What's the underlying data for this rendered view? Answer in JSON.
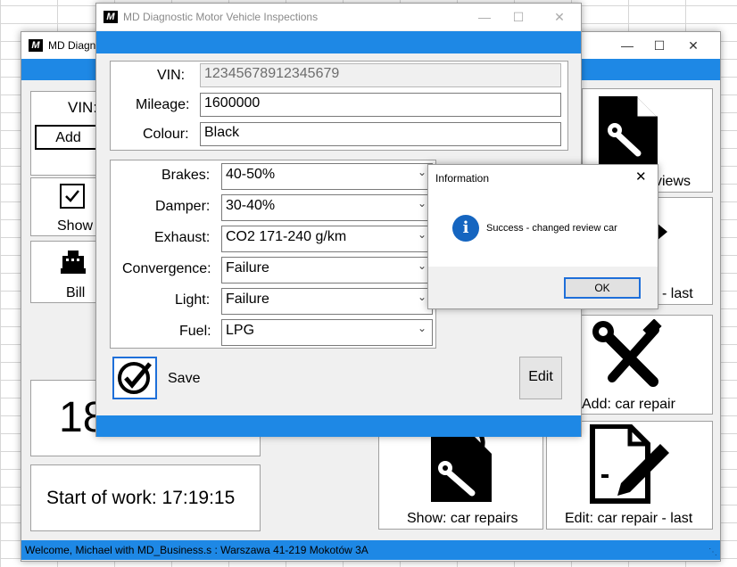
{
  "back_window": {
    "title": "MD Diagnost",
    "vin_label": "VIN:",
    "add_label": "Add",
    "show_label": "Show",
    "bill_label": "Bill",
    "big_number": "18",
    "start_of_work": "Start of work: 17:19:15",
    "reviews_label": "views",
    "last_label": "- last",
    "add_repair_label": "Add: car repair",
    "show_repairs_label": "Show: car repairs",
    "edit_repair_label": "Edit: car repair - last",
    "status_text": "Welcome, Michael with MD_Business.s : Warszawa 41-219 Mokotów 3A"
  },
  "main_window": {
    "title": "MD Diagnostic Motor Vehicle Inspections",
    "fields": {
      "vin_label": "VIN:",
      "vin_value": "12345678912345679",
      "mileage_label": "Mileage:",
      "mileage_value": "1600000",
      "colour_label": "Colour:",
      "colour_value": "Black"
    },
    "rows": [
      {
        "label": "Brakes:",
        "value": "40-50%"
      },
      {
        "label": "Damper:",
        "value": "30-40%"
      },
      {
        "label": "Exhaust:",
        "value": "CO2 171-240 g/km"
      },
      {
        "label": "Convergence:",
        "value": "Failure"
      },
      {
        "label": "Light:",
        "value": "Failure"
      },
      {
        "label": "Fuel:",
        "value": "LPG"
      }
    ],
    "save_label": "Save",
    "edit_label": "Edit"
  },
  "dialog": {
    "title": "Information",
    "message": "Success - changed review car",
    "ok_label": "OK"
  },
  "colors": {
    "accent": "#1e88e5",
    "info": "#1565c0"
  }
}
